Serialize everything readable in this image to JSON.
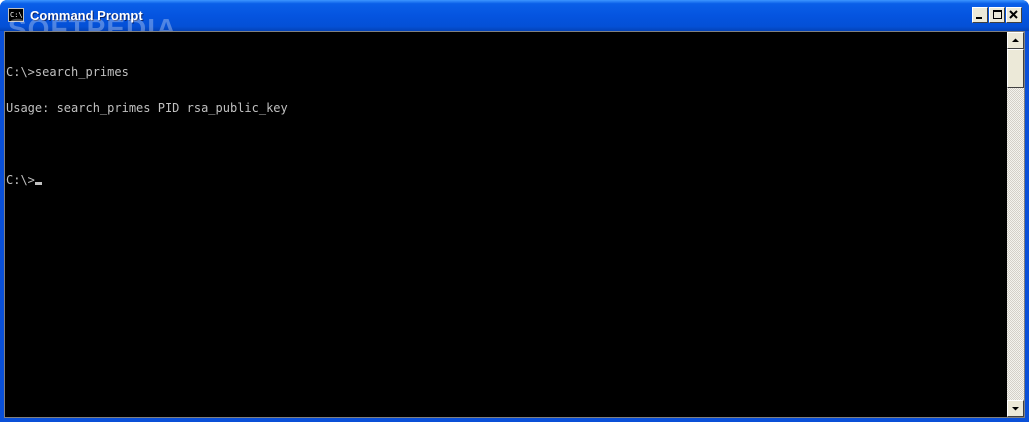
{
  "window": {
    "title": "Command Prompt",
    "icon": "cmd-icon",
    "icon_text": "C:\\",
    "watermark": "SOFTPEDIA",
    "controls": [
      "minimize-icon",
      "restore-icon",
      "close-icon"
    ]
  },
  "console": {
    "lines": [
      "C:\\>search_primes",
      "Usage: search_primes PID rsa_public_key",
      "",
      "C:\\>"
    ],
    "foreground": "#c0c0c0",
    "background": "#000000"
  },
  "colors": {
    "titlebar": "#0554e0",
    "frame": "#0a50d8",
    "scrollbar": "#ece9d8"
  },
  "scrollbar": {
    "up_icon": "arrow-up-icon",
    "down_icon": "arrow-down-icon"
  }
}
